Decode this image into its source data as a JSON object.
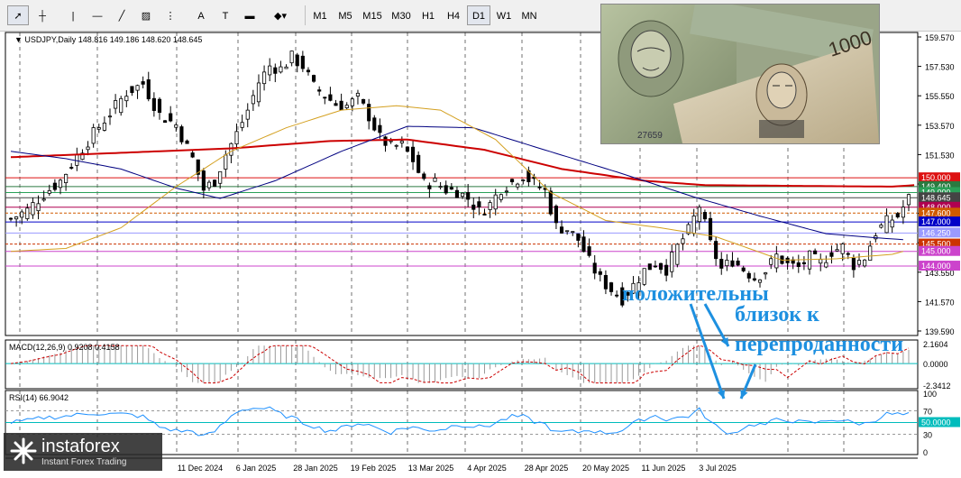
{
  "toolbar": {
    "tools": [
      {
        "name": "cursor-tool",
        "glyph": "➚"
      },
      {
        "name": "crosshair-tool",
        "glyph": "┼"
      },
      {
        "name": "vertical-line-tool",
        "glyph": "|"
      },
      {
        "name": "horizontal-line-tool",
        "glyph": "—"
      },
      {
        "name": "trendline-tool",
        "glyph": "╱"
      },
      {
        "name": "channel-tool",
        "glyph": "▨"
      },
      {
        "name": "fibonacci-tool",
        "glyph": "⋮"
      },
      {
        "name": "text-tool",
        "glyph": "A"
      },
      {
        "name": "label-tool",
        "glyph": "T"
      },
      {
        "name": "rectangle-tool",
        "glyph": "▬"
      },
      {
        "name": "shapes-menu-tool",
        "glyph": "◆▾"
      }
    ],
    "timeframes": [
      "M1",
      "M5",
      "M15",
      "M30",
      "H1",
      "H4",
      "D1",
      "W1",
      "MN"
    ],
    "active_timeframe": "D1"
  },
  "chart_data": [
    {
      "type": "candlestick",
      "title": "USDJPY,Daily",
      "ohlc_header": "148.816 149.186 148.620 148.645",
      "x_tick_labels": [
        "",
        "11 Dec 2024",
        "6 Jan 2025",
        "28 Jan 2025",
        "19 Feb 2025",
        "13 Mar 2025",
        "4 Apr 2025",
        "28 Apr 2025",
        "20 May 2025",
        "11 Jun 2025",
        "3 Jul 2025"
      ],
      "y_tick_labels": [
        "159.570",
        "157.530",
        "155.550",
        "153.570",
        "151.530",
        "149.550",
        "147.530",
        "145.530",
        "143.550",
        "141.570",
        "139.590"
      ],
      "ylim": [
        139.59,
        159.57
      ],
      "close_path": [
        [
          0,
          147.2
        ],
        [
          3,
          147.8
        ],
        [
          6,
          148.9
        ],
        [
          9,
          149.8
        ],
        [
          12,
          151.5
        ],
        [
          15,
          153.0
        ],
        [
          18,
          154.4
        ],
        [
          21,
          155.8
        ],
        [
          24,
          156.4
        ],
        [
          27,
          154.3
        ],
        [
          30,
          153.6
        ],
        [
          33,
          151.3
        ],
        [
          35,
          149.2
        ],
        [
          37,
          149.8
        ],
        [
          39,
          151.6
        ],
        [
          41,
          153.0
        ],
        [
          43,
          154.6
        ],
        [
          45,
          156.5
        ],
        [
          47,
          157.6
        ],
        [
          49,
          157.4
        ],
        [
          51,
          158.2
        ],
        [
          53,
          157.6
        ],
        [
          55,
          156.2
        ],
        [
          57,
          155.6
        ],
        [
          59,
          155.0
        ],
        [
          61,
          154.9
        ],
        [
          63,
          155.4
        ],
        [
          65,
          154.2
        ],
        [
          67,
          152.7
        ],
        [
          69,
          152.1
        ],
        [
          71,
          152.2
        ],
        [
          73,
          151.2
        ],
        [
          75,
          149.6
        ],
        [
          77,
          149.7
        ],
        [
          79,
          149.2
        ],
        [
          81,
          149.1
        ],
        [
          83,
          148.6
        ],
        [
          85,
          147.7
        ],
        [
          87,
          148.2
        ],
        [
          89,
          149.3
        ],
        [
          91,
          149.7
        ],
        [
          93,
          150.2
        ],
        [
          95,
          149.6
        ],
        [
          97,
          149.1
        ],
        [
          99,
          146.7
        ],
        [
          101,
          146.5
        ],
        [
          103,
          145.8
        ],
        [
          105,
          144.3
        ],
        [
          107,
          143.1
        ],
        [
          109,
          142.4
        ],
        [
          111,
          141.8
        ],
        [
          113,
          142.7
        ],
        [
          115,
          143.7
        ],
        [
          117,
          144.2
        ],
        [
          119,
          143.8
        ],
        [
          121,
          145.3
        ],
        [
          123,
          146.4
        ],
        [
          125,
          148.1
        ],
        [
          127,
          145.5
        ],
        [
          129,
          143.8
        ],
        [
          131,
          144.4
        ],
        [
          133,
          143.8
        ],
        [
          135,
          143.2
        ],
        [
          137,
          143.7
        ],
        [
          139,
          144.7
        ],
        [
          141,
          144.1
        ],
        [
          143,
          143.9
        ],
        [
          145,
          144.6
        ],
        [
          147,
          144.2
        ],
        [
          149,
          145.0
        ],
        [
          151,
          145.3
        ],
        [
          153,
          144.1
        ],
        [
          155,
          144.6
        ],
        [
          157,
          146.3
        ],
        [
          159,
          147.0
        ],
        [
          161,
          147.4
        ],
        [
          163,
          148.6
        ]
      ],
      "series": [
        {
          "name": "",
          "color": "#cc0000",
          "values": [
            [
              0,
              151.4
            ],
            [
              40,
              152.0
            ],
            [
              58,
              152.5
            ],
            [
              72,
              152.6
            ],
            [
              86,
              151.9
            ],
            [
              100,
              150.6
            ],
            [
              115,
              149.8
            ],
            [
              126,
              149.5
            ],
            [
              160,
              149.4
            ],
            [
              164,
              149.5
            ]
          ]
        },
        {
          "name": "",
          "color": "#000080",
          "values": [
            [
              0,
              151.8
            ],
            [
              10,
              151.3
            ],
            [
              20,
              150.6
            ],
            [
              30,
              149.3
            ],
            [
              38,
              148.6
            ],
            [
              48,
              149.8
            ],
            [
              60,
              151.8
            ],
            [
              72,
              153.5
            ],
            [
              84,
              153.4
            ],
            [
              96,
              152.0
            ],
            [
              110,
              150.4
            ],
            [
              124,
              148.7
            ],
            [
              136,
              147.4
            ],
            [
              148,
              146.2
            ],
            [
              158,
              145.9
            ],
            [
              162,
              145.8
            ]
          ]
        },
        {
          "name": "",
          "color": "#d4a020",
          "values": [
            [
              0,
              145.0
            ],
            [
              10,
              145.2
            ],
            [
              20,
              146.6
            ],
            [
              30,
              149.4
            ],
            [
              40,
              151.8
            ],
            [
              50,
              153.4
            ],
            [
              60,
              154.6
            ],
            [
              70,
              154.9
            ],
            [
              78,
              154.6
            ],
            [
              88,
              152.6
            ],
            [
              98,
              149.0
            ],
            [
              108,
              147.1
            ],
            [
              118,
              146.6
            ],
            [
              128,
              146.0
            ],
            [
              140,
              144.4
            ],
            [
              150,
              144.5
            ],
            [
              160,
              144.8
            ],
            [
              162,
              145.0
            ]
          ]
        }
      ],
      "price_levels": [
        {
          "value": 150.0,
          "label": "150.000",
          "color": "#dd1111"
        },
        {
          "value": 149.4,
          "label": "149.400",
          "color": "#2c7a40"
        },
        {
          "value": 149.0,
          "label": "149.000",
          "color": "#2aa058"
        },
        {
          "value": 148.645,
          "label": "148.645",
          "color": "#444444"
        },
        {
          "value": 148.0,
          "label": "148.000",
          "color": "#b00050"
        },
        {
          "value": 147.6,
          "label": "147.600",
          "color": "#d05a00"
        },
        {
          "value": 147.0,
          "label": "147.000",
          "color": "#0000c8"
        },
        {
          "value": 146.25,
          "label": "146.250",
          "color": "#9a9aff"
        },
        {
          "value": 145.5,
          "label": "145.500",
          "color": "#cc3300"
        },
        {
          "value": 145.0,
          "label": "145.000",
          "color": "#cc44cc"
        },
        {
          "value": 144.0,
          "label": "144.000",
          "color": "#cc44cc"
        }
      ]
    },
    {
      "type": "bar",
      "title": "MACD(12,26,9) 0.9208 0.4158",
      "y_tick_labels": [
        "2.1604",
        "0.0000",
        "-2.3412"
      ],
      "ylim": [
        -2.3412,
        2.1604
      ]
    },
    {
      "type": "line",
      "title": "RSI(14) 66.9042",
      "y_tick_labels": [
        "100",
        "70",
        "50.0000",
        "30",
        "0"
      ],
      "ylim": [
        0,
        100
      ],
      "levels": [
        70,
        50,
        30
      ],
      "last_value": 66.9042
    }
  ],
  "annotations": {
    "line1": "положительны",
    "line2": "близок к",
    "line3": "перепроданности"
  },
  "logo": {
    "name": "instaforex",
    "subtitle": "Instant Forex Trading"
  },
  "colors": {
    "bull": "#000000",
    "bear": "#000000",
    "grid": "#000000",
    "rsi_line": "#1e90ff",
    "rsi_level": "#00bcbc",
    "annot": "#1e90e0"
  }
}
